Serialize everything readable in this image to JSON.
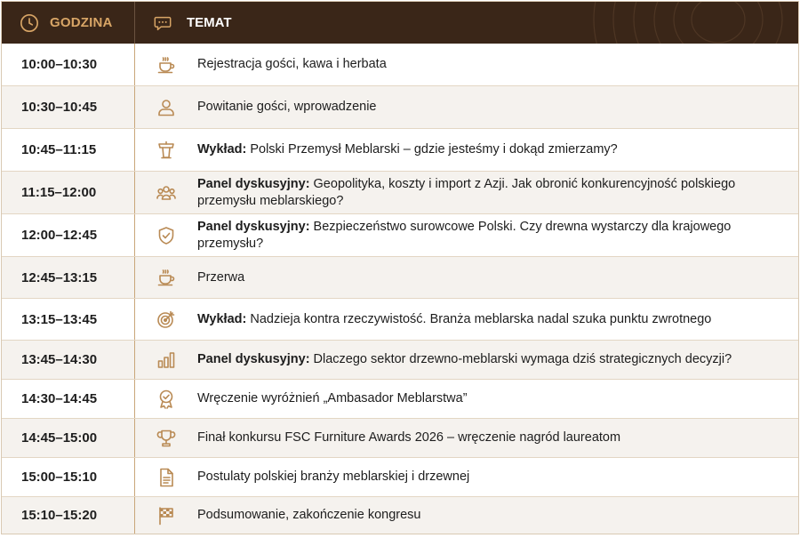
{
  "header": {
    "time_label": "GODZINA",
    "topic_label": "TEMAT"
  },
  "colors": {
    "header_bg": "#3a2618",
    "accent": "#b98a54",
    "header_time_text": "#d8a566",
    "row_alt": "#f5f2ee"
  },
  "rows": [
    {
      "time": "10:00–10:30",
      "icon": "coffee-cup-icon",
      "prefix": "",
      "topic": "Rejestracja gości, kawa i herbata"
    },
    {
      "time": "10:30–10:45",
      "icon": "person-icon",
      "prefix": "",
      "topic": "Powitanie gości, wprowadzenie"
    },
    {
      "time": "10:45–11:15",
      "icon": "podium-icon",
      "prefix": "Wykład:",
      "topic": "Polski Przemysł Meblarski – gdzie jesteśmy i dokąd zmierzamy?"
    },
    {
      "time": "11:15–12:00",
      "icon": "group-icon",
      "prefix": "Panel dyskusyjny:",
      "topic": "Geopolityka, koszty i import z Azji. Jak obronić konkurencyjność polskiego przemysłu meblarskiego?"
    },
    {
      "time": "12:00–12:45",
      "icon": "shield-check-icon",
      "prefix": "Panel dyskusyjny:",
      "topic": "Bezpieczeństwo surowcowe Polski. Czy drewna wystarczy dla krajowego przemysłu?"
    },
    {
      "time": "12:45–13:15",
      "icon": "coffee-cup-icon",
      "prefix": "",
      "topic": "Przerwa"
    },
    {
      "time": "13:15–13:45",
      "icon": "target-icon",
      "prefix": "Wykład:",
      "topic": "Nadzieja kontra rzeczywistość. Branża meblarska nadal szuka punktu zwrotnego"
    },
    {
      "time": "13:45–14:30",
      "icon": "bar-chart-icon",
      "prefix": "Panel dyskusyjny:",
      "topic": "Dlaczego sektor drzewno-meblarski wymaga dziś strategicznych decyzji?"
    },
    {
      "time": "14:30–14:45",
      "icon": "award-badge-icon",
      "prefix": "",
      "topic": "Wręczenie wyróżnień „Ambasador Meblarstwa”"
    },
    {
      "time": "14:45–15:00",
      "icon": "trophy-icon",
      "prefix": "",
      "topic": "Finał konkursu FSC Furniture Awards 2026 – wręczenie nagród laureatom"
    },
    {
      "time": "15:00–15:10",
      "icon": "document-icon",
      "prefix": "",
      "topic": "Postulaty polskiej branży meblarskiej i drzewnej"
    },
    {
      "time": "15:10–15:20",
      "icon": "checkered-flag-icon",
      "prefix": "",
      "topic": "Podsumowanie, zakończenie kongresu"
    }
  ]
}
